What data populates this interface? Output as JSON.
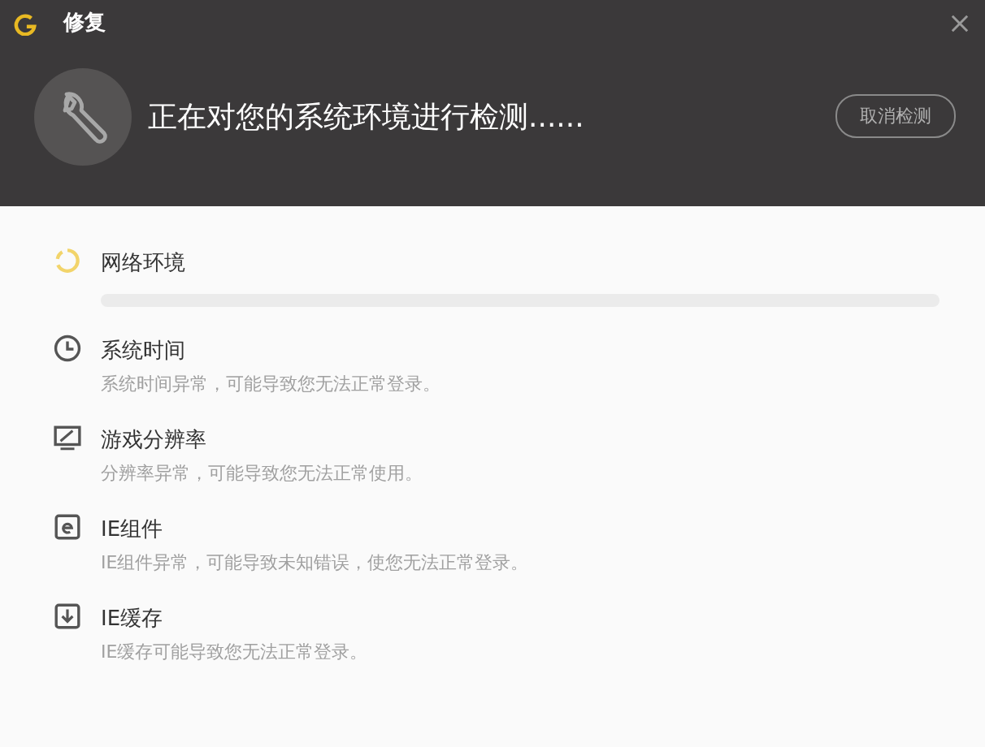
{
  "window": {
    "title": "修复"
  },
  "header": {
    "message": "正在对您的系统环境进行检测......",
    "cancel_button": "取消检测"
  },
  "checks": [
    {
      "kind": "loading",
      "title": "网络环境"
    },
    {
      "kind": "clock",
      "title": "系统时间",
      "description": "系统时间异常，可能导致您无法正常登录。"
    },
    {
      "kind": "monitor",
      "title": "游戏分辨率",
      "description": "分辨率异常，可能导致您无法正常使用。"
    },
    {
      "kind": "ie",
      "title": "IE组件",
      "description": "IE组件异常，可能导致未知错误，使您无法正常登录。"
    },
    {
      "kind": "download",
      "title": "IE缓存",
      "description": "IE缓存可能导致您无法正常登录。"
    }
  ]
}
